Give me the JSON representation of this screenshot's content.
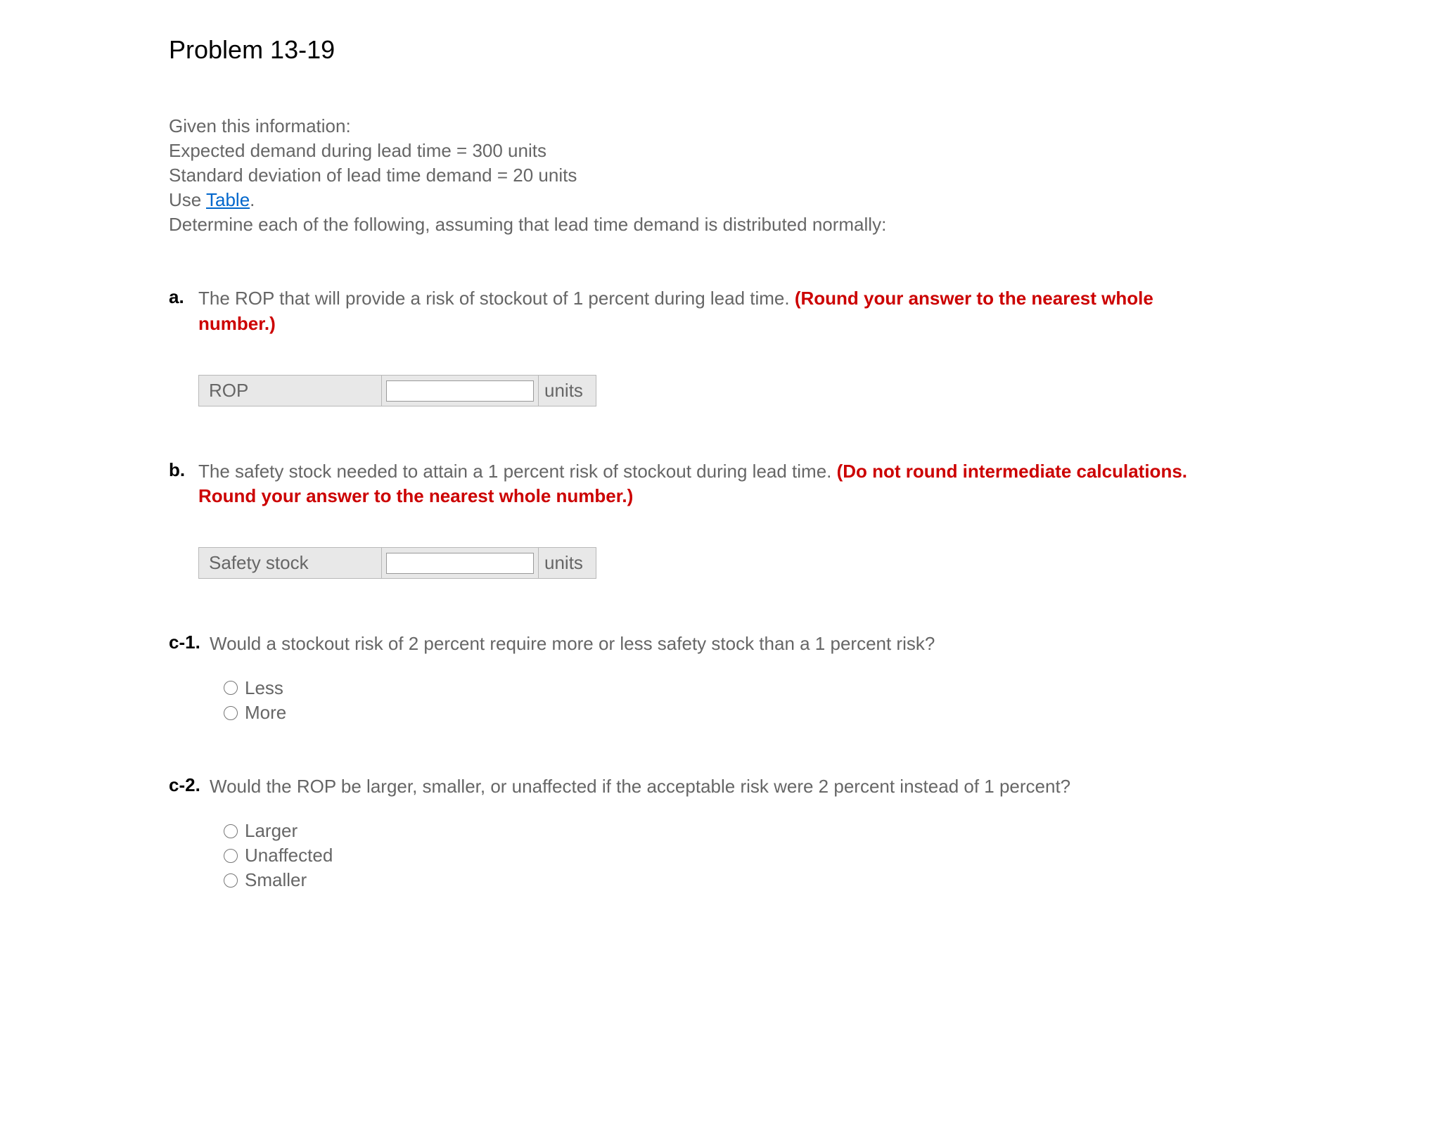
{
  "title": "Problem 13-19",
  "intro": {
    "line1": "Given this information:",
    "line2": "Expected demand during lead time = 300 units",
    "line3": "Standard deviation of lead time demand = 20 units",
    "line4_prefix": "Use ",
    "table_link": "Table",
    "line4_suffix": ".",
    "line5": "Determine each of the following, assuming that lead time demand is distributed normally:"
  },
  "qa": {
    "letter": "a.",
    "text_black": "The ROP that will provide a risk of stockout of 1 percent during lead time. ",
    "text_red": "(Round your answer to the nearest whole number.)",
    "label": "ROP",
    "unit": "units",
    "value": ""
  },
  "qb": {
    "letter": "b.",
    "text_black": "The safety stock needed to attain a 1 percent risk of stockout during lead time. ",
    "text_red": "(Do not round intermediate calculations. Round your answer to the nearest whole number.)",
    "label": "Safety stock",
    "unit": "units",
    "value": ""
  },
  "qc1": {
    "letter": "c-1.",
    "text": "Would a stockout risk of 2 percent require more or less safety stock than a 1 percent risk?",
    "options": [
      "Less",
      "More"
    ]
  },
  "qc2": {
    "letter": "c-2.",
    "text": "Would the ROP be larger, smaller, or unaffected if the acceptable risk were 2 percent instead of 1 percent?",
    "options": [
      "Larger",
      "Unaffected",
      "Smaller"
    ]
  }
}
